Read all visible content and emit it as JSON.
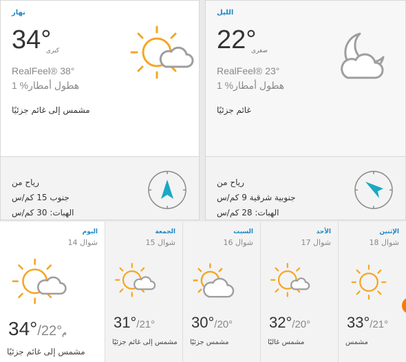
{
  "day": {
    "header": "نهار",
    "temp": "34",
    "deg": "°",
    "sublabel": "كبرى",
    "realfeel": "RealFeel® 38°",
    "precip": "1 %هطول أمطار",
    "phrase": "مشمس إلى غائم جزئيًا",
    "icon": "sun-cloud-icon",
    "wind_title": "رياح من",
    "wind_speed": "جنوب 15 كم/س",
    "wind_gusts": "الهبات: 30 كم/س",
    "wind_icon": "wind-arrow-north-icon"
  },
  "night": {
    "header": "الليل",
    "temp": "22",
    "deg": "°",
    "sublabel": "صغرى",
    "realfeel": "RealFeel® 23°",
    "precip": "1 %هطول أمطار",
    "phrase": "غائم جزئيًا",
    "icon": "moon-cloud-icon",
    "wind_title": "رياح من",
    "wind_speed": "جنوبية شرقية 9 كم/س",
    "wind_gusts": "الهبات: 28 كم/س",
    "wind_icon": "wind-arrow-northwest-icon"
  },
  "forecast": [
    {
      "day": "اليوم",
      "date": "شوال 14",
      "hi": "34°",
      "lo": "/22°",
      "unit": "م",
      "phrase": "مشمس إلى غائم جزئيًا",
      "icon": "sun-cloud-icon"
    },
    {
      "day": "الجمعة",
      "date": "شوال 15",
      "hi": "31°",
      "lo": "/21°",
      "phrase": "مشمس إلى غائم جزئيًا",
      "icon": "sun-cloud-icon"
    },
    {
      "day": "السبت",
      "date": "شوال 16",
      "hi": "30°",
      "lo": "/20°",
      "phrase": "مشمس جزئيًا",
      "icon": "sun-cloud-icon"
    },
    {
      "day": "الأحد",
      "date": "شوال 17",
      "hi": "32°",
      "lo": "/20°",
      "phrase": "مشمس غالبًا",
      "icon": "sun-cloud-icon"
    },
    {
      "day": "الإثنين",
      "date": "شوال 18",
      "hi": "33°",
      "lo": "/21°",
      "phrase": "مشمس",
      "icon": "sun-icon"
    }
  ],
  "colors": {
    "accent": "#1f88c7",
    "sun": "#f5a623",
    "cloud": "#9e9e9e",
    "wind_arrow": "#1aa8c4",
    "tab": "#f57c00"
  }
}
